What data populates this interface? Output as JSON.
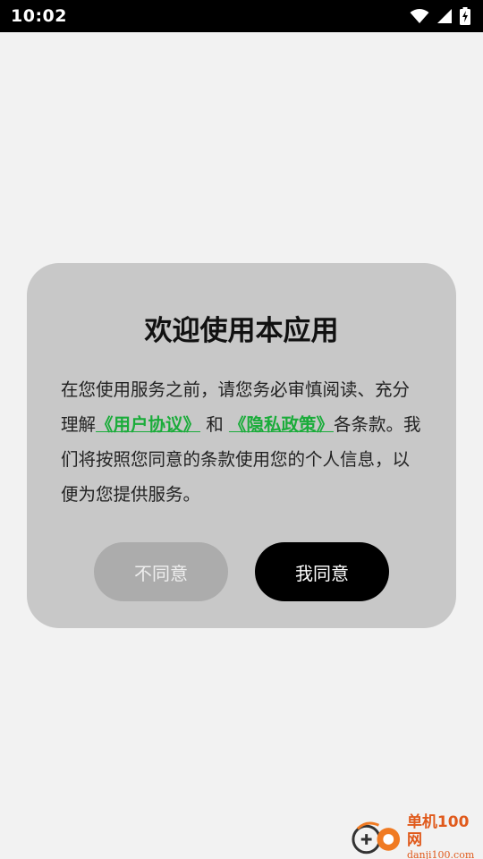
{
  "status_bar": {
    "time": "10:02",
    "icons": [
      "wifi-icon",
      "cellular-signal-icon",
      "battery-charging-icon"
    ]
  },
  "dialog": {
    "title": "欢迎使用本应用",
    "body": {
      "part1": "在您使用服务之前，请您务必审慎阅读、充分理解",
      "link_user_agreement": "《用户协议》",
      "part2": " 和 ",
      "link_privacy_policy": "《隐私政策》",
      "part3": "各条款。我们将按照您同意的条款使用您的个人信息，以便为您提供服务。"
    },
    "disagree_label": "不同意",
    "agree_label": "我同意"
  },
  "watermark": {
    "name": "单机100网",
    "url": "danji100.com"
  },
  "colors": {
    "background": "#f2f2f2",
    "dialog": "#c8c8c8",
    "link": "#1aac3a",
    "agree_button": "#000000",
    "disagree_button": "#acacac"
  }
}
